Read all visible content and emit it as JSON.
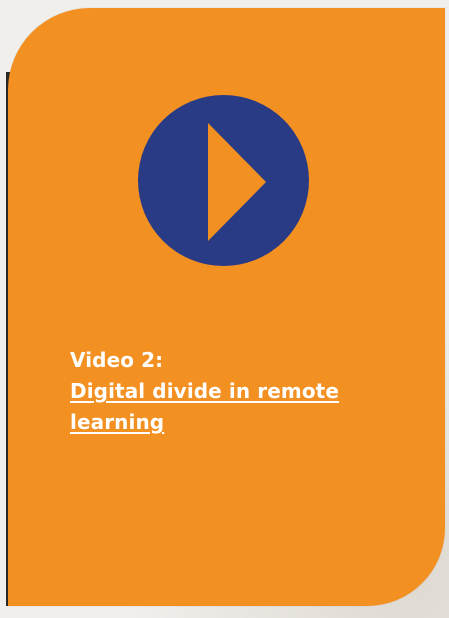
{
  "card": {
    "eyebrow": "Video 2:",
    "title": "Digital divide in remote learning",
    "play_icon": "play-icon",
    "colors": {
      "card": "#f39022",
      "play": "#293b85",
      "text": "#ffffff"
    }
  }
}
